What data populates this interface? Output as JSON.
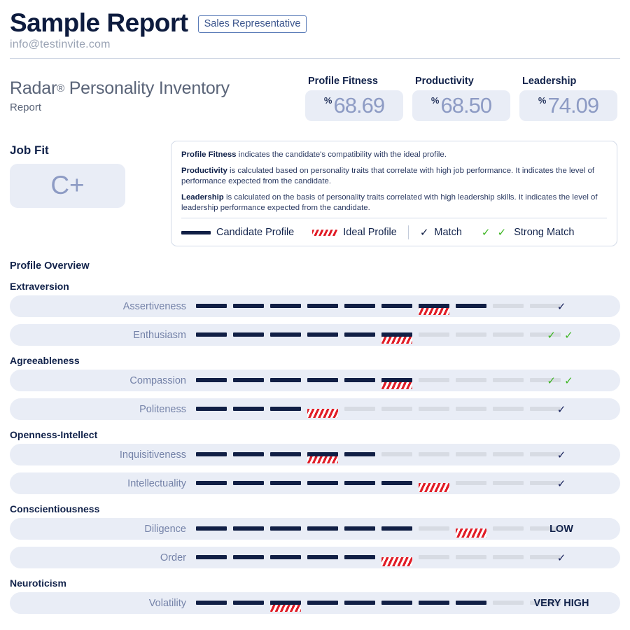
{
  "header": {
    "title": "Sample Report",
    "role_badge": "Sales Representative",
    "email": "info@testinvite.com"
  },
  "inventory": {
    "title": "Radar",
    "registered": "®",
    "title_rest": " Personality Inventory",
    "subtitle": "Report"
  },
  "scores": [
    {
      "label": "Profile Fitness",
      "percent_sign": "%",
      "value": "68.69"
    },
    {
      "label": "Productivity",
      "percent_sign": "%",
      "value": "68.50"
    },
    {
      "label": "Leadership",
      "percent_sign": "%",
      "value": "74.09"
    }
  ],
  "job_fit": {
    "label": "Job Fit",
    "grade": "C+"
  },
  "info_card": {
    "paragraphs": [
      {
        "term": "Profile Fitness",
        "text": " indicates the candidate's compatibility with the ideal profile."
      },
      {
        "term": "Productivity",
        "text": " is calculated based on personality traits that correlate with high job performance. It indicates the level of performance expected from the candidate."
      },
      {
        "term": "Leadership",
        "text": " is calculated on the basis of personality traits correlated with high leadership skills. It indicates the level of leadership performance expected from the candidate."
      }
    ],
    "legend": {
      "candidate": "Candidate Profile",
      "ideal": "Ideal Profile",
      "match": "Match",
      "match_mark": "✓",
      "strong": "Strong Match",
      "strong_mark": "✓ ✓"
    }
  },
  "overview": {
    "title": "Profile Overview"
  },
  "colors": {
    "candidate_navy": "#111f45",
    "ideal_red": "#e11d27",
    "empty_gray": "#d7dbe3",
    "row_bg": "#e9edf6",
    "label_gray": "#7482a8",
    "strong_green": "#3cb521"
  },
  "chart_data": {
    "type": "bar",
    "title": "Profile Overview",
    "scale_max": 10,
    "legend": [
      "Candidate Profile",
      "Ideal Profile",
      "Match",
      "Strong Match"
    ],
    "groups": [
      {
        "name": "Extraversion",
        "traits": [
          {
            "name": "Assertiveness",
            "candidate": 8,
            "ideal": 7,
            "status": "✓",
            "status_type": "match"
          },
          {
            "name": "Enthusiasm",
            "candidate": 6,
            "ideal": 6,
            "status": "✓ ✓",
            "status_type": "strong"
          }
        ]
      },
      {
        "name": "Agreeableness",
        "traits": [
          {
            "name": "Compassion",
            "candidate": 6,
            "ideal": 6,
            "status": "✓ ✓",
            "status_type": "strong"
          },
          {
            "name": "Politeness",
            "candidate": 3,
            "ideal": 4,
            "status": "✓",
            "status_type": "match"
          }
        ]
      },
      {
        "name": "Openness-Intellect",
        "traits": [
          {
            "name": "Inquisitiveness",
            "candidate": 5,
            "ideal": 4,
            "status": "✓",
            "status_type": "match"
          },
          {
            "name": "Intellectuality",
            "candidate": 6,
            "ideal": 7,
            "status": "✓",
            "status_type": "match"
          }
        ]
      },
      {
        "name": "Conscientiousness",
        "traits": [
          {
            "name": "Diligence",
            "candidate": 6,
            "ideal": 8,
            "status": "LOW",
            "status_type": "text"
          },
          {
            "name": "Order",
            "candidate": 5,
            "ideal": 6,
            "status": "✓",
            "status_type": "match"
          }
        ]
      },
      {
        "name": "Neuroticism",
        "traits": [
          {
            "name": "Volatility",
            "candidate": 8,
            "ideal": 3,
            "status": "VERY HIGH",
            "status_type": "text"
          }
        ]
      }
    ]
  }
}
